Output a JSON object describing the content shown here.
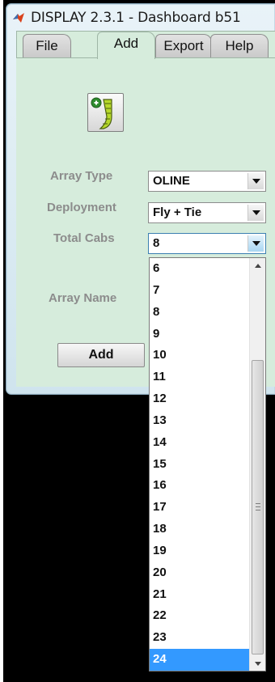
{
  "window": {
    "title": "DISPLAY 2.3.1 - Dashboard  b51"
  },
  "menu_tabs": [
    {
      "label": "File"
    },
    {
      "label": "Add"
    },
    {
      "label": "Export"
    },
    {
      "label": "Help"
    }
  ],
  "active_tab": "Add",
  "form": {
    "array_type_label": "Array Type",
    "array_type_value": "OLINE",
    "deployment_label": "Deployment",
    "deployment_value": "Fly + Tie",
    "total_cabs_label": "Total Cabs",
    "total_cabs_value": "8",
    "array_name_label": "Array Name",
    "add_button_label": "Add"
  },
  "dropdown": {
    "options": [
      "6",
      "7",
      "8",
      "9",
      "10",
      "11",
      "12",
      "13",
      "14",
      "15",
      "16",
      "17",
      "18",
      "19",
      "20",
      "21",
      "22",
      "23",
      "24"
    ],
    "highlighted": "24"
  },
  "icons": {
    "app": "matlab-logo-icon",
    "add_array": "loudspeaker-array-add-icon"
  },
  "colors": {
    "panel_bg": "#d6ecdc",
    "selection": "#3399ff",
    "desktop": "#000000"
  }
}
